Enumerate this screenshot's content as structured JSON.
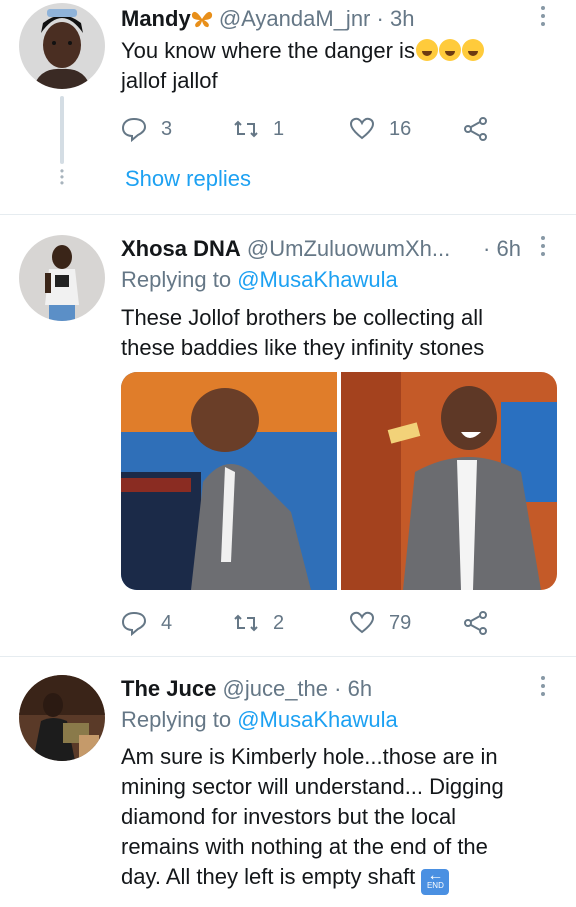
{
  "tweets": [
    {
      "name": "Mandy",
      "handle": "@AyandaM_jnr",
      "sep": "·",
      "time": "3h",
      "text_line1": "You know where the danger is",
      "text_line2": "jallof jallof",
      "replies": "3",
      "retweets": "1",
      "likes": "16",
      "show_replies": "Show replies"
    },
    {
      "name": "Xhosa DNA",
      "handle": "@UmZuluowumXh...",
      "sep": "·",
      "time": "6h",
      "replying_prefix": "Replying to ",
      "replying_to": "@MusaKhawula",
      "text_line1": "These Jollof brothers be collecting all",
      "text_line2": "these baddies like they infinity stones",
      "replies": "4",
      "retweets": "2",
      "likes": "79"
    },
    {
      "name": "The Juce",
      "handle": "@juce_the",
      "sep": "·",
      "time": "6h",
      "replying_prefix": "Replying to ",
      "replying_to": "@MusaKhawula",
      "text_line1": "Am sure is Kimberly hole...those are in",
      "text_line2": "mining sector will understand... Digging",
      "text_line3": "diamond for investors but the local",
      "text_line4": "remains with nothing at the end of the",
      "text_line5": "day. All they left is empty shaft",
      "end_icon_label": "END"
    }
  ],
  "colors": {
    "accent": "#1da1f2",
    "secondary": "#657786",
    "divider": "#e6ecf0"
  },
  "icons": [
    "reply-icon",
    "retweet-icon",
    "like-icon",
    "share-icon",
    "more-icon",
    "end-arrow-icon"
  ]
}
